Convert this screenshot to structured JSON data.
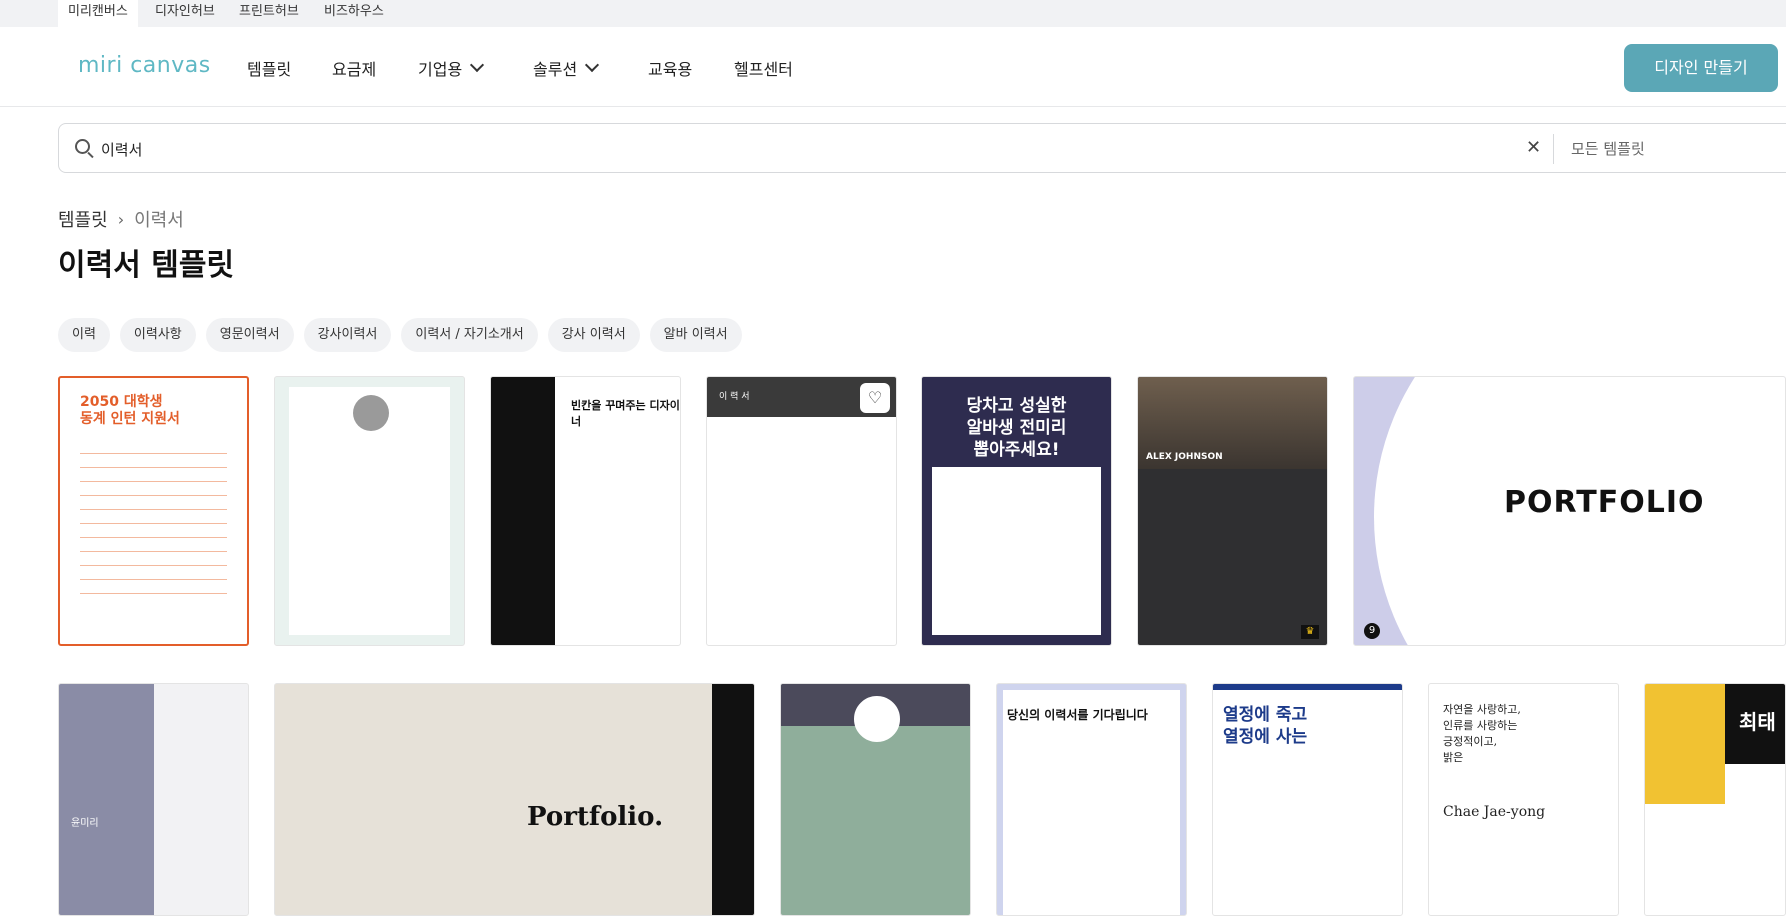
{
  "topbar": {
    "tabs": [
      {
        "label": "미리캔버스",
        "active": true
      },
      {
        "label": "디자인허브",
        "active": false
      },
      {
        "label": "프린트허브",
        "active": false
      },
      {
        "label": "비즈하우스",
        "active": false
      }
    ]
  },
  "header": {
    "logo": "miri canvas",
    "nav": [
      {
        "label": "템플릿",
        "dropdown": false
      },
      {
        "label": "요금제",
        "dropdown": false
      },
      {
        "label": "기업용",
        "dropdown": true
      },
      {
        "label": "솔루션",
        "dropdown": true
      },
      {
        "label": "교육용",
        "dropdown": false
      },
      {
        "label": "헬프센터",
        "dropdown": false
      }
    ],
    "cta_label": "디자인 만들기",
    "cta_color": "#5ba7b6"
  },
  "search": {
    "value": "이력서",
    "clear_icon": "close-icon",
    "scope_label": "모든 템플릿"
  },
  "breadcrumb": {
    "root": "템플릿",
    "current": "이력서"
  },
  "page_title": "이력서 템플릿",
  "chips": [
    "이력",
    "이력사항",
    "영문이력서",
    "강사이력서",
    "이력서 / 자기소개서",
    "강사 이력서",
    "알바 이력서"
  ],
  "thumbnails": {
    "t1": {
      "heading": "2050 대학생\n동계 인턴 지원서"
    },
    "t3": {
      "heading": "빈칸을 꾸며주는 디자이너"
    },
    "t4": {
      "heading": "이 력 서"
    },
    "t5": {
      "heading": "당차고 성실한\n알바생 전미리\n뽑아주세요!"
    },
    "t6": {
      "name": "ALEX JOHNSON"
    },
    "t7": {
      "word": "PORTFOLIO"
    },
    "t8": {
      "name": "윤미리"
    },
    "t9": {
      "word": "Portfolio."
    },
    "t11": {
      "heading": "당신의 이력서를 기다립니다"
    },
    "t12": {
      "heading": "열정에 죽고\n열정에 사는"
    },
    "t13": {
      "heading": "자연을 사랑하고,\n인류를 사랑하는\n긍정적이고,\n밝은",
      "name": "Chae Jae-yong"
    },
    "t14": {
      "heading": "최태"
    }
  }
}
